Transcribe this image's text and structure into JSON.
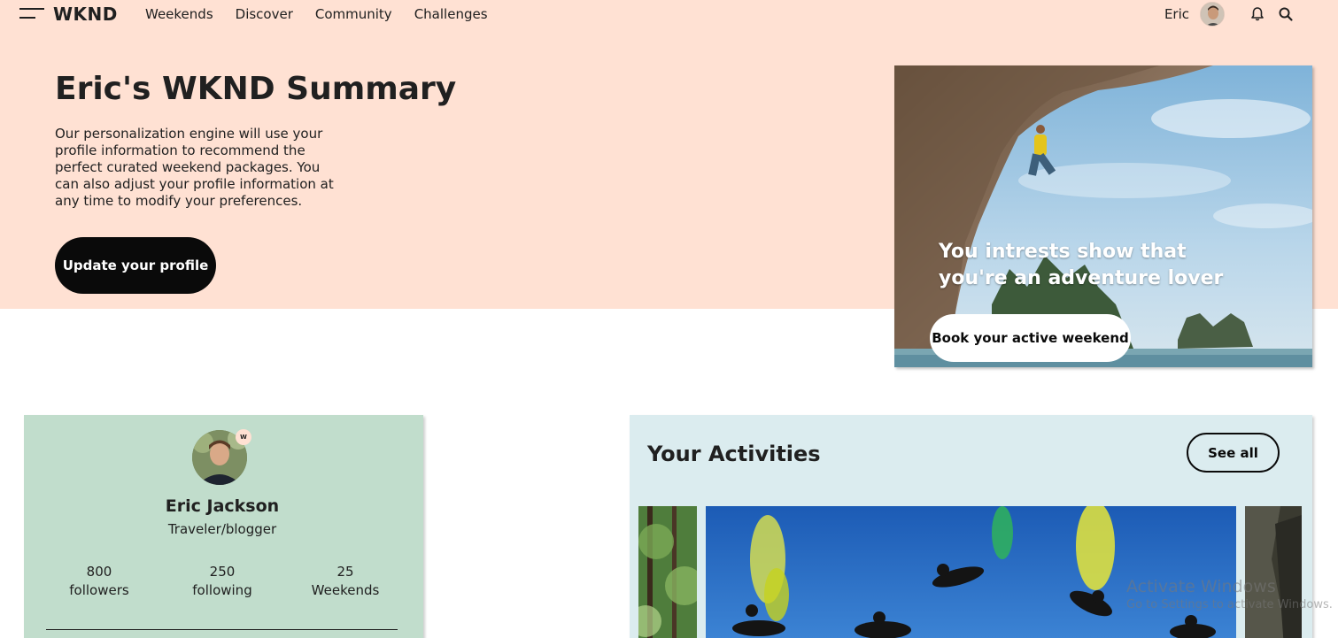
{
  "nav": {
    "logo": "WKND",
    "links": [
      "Weekends",
      "Discover",
      "Community",
      "Challenges"
    ],
    "user_name": "Eric",
    "icons": [
      "hamburger-menu-icon",
      "bell-icon",
      "search-icon"
    ]
  },
  "hero": {
    "title": "Eric's WKND Summary",
    "description": "Our personalization engine will use your profile information to recommend the perfect curated weekend packages. You can also adjust your profile information at any time to modify your preferences.",
    "cta_label": "Update your profile",
    "card_text": "You intrests show that you're an adventure lover",
    "card_cta_label": "Book your active weekend"
  },
  "profile": {
    "badge": "W",
    "name": "Eric Jackson",
    "role": "Traveler/blogger",
    "stats": [
      {
        "value": "800",
        "label": "followers"
      },
      {
        "value": "250",
        "label": "following"
      },
      {
        "value": "25",
        "label": "Weekends"
      }
    ]
  },
  "activities": {
    "title": "Your Activities",
    "see_all_label": "See all"
  },
  "watermark": {
    "line1": "Activate Windows",
    "line2": "Go to Settings to activate Windows."
  },
  "colors": {
    "hero_band": "#ffe1d3",
    "profile_card": "#c1ddcc",
    "activities_card": "#dbecef",
    "dark_button": "#0a0a0a"
  }
}
